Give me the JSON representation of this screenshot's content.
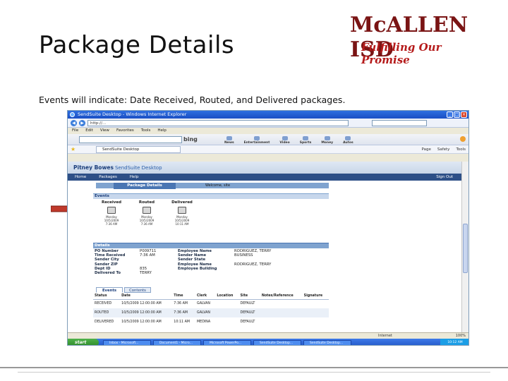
{
  "slide": {
    "title": "Package Details",
    "subtitle": "Events will indicate: Date Received, Routed, and Delivered packages."
  },
  "logo": {
    "name": "McALLEN ISD",
    "tagline": "Fulfilling Our Promise"
  },
  "browser": {
    "window_title": "SendSuite Desktop - Windows Internet Explorer",
    "address": "http://...",
    "menu": [
      "File",
      "Edit",
      "View",
      "Favorites",
      "Tools",
      "Help"
    ],
    "bing": {
      "logo": "bing",
      "items": [
        "News",
        "Entertainment",
        "Video",
        "Sports",
        "Money",
        "Autos"
      ]
    },
    "tab_label": "SendSuite Desktop",
    "tools": [
      "Page",
      "Safety",
      "Tools"
    ]
  },
  "app": {
    "brand": "Pitney Bowes",
    "product": "SendSuite Desktop",
    "nav": [
      "Home",
      "Packages",
      "Help"
    ],
    "signout": "Sign Out",
    "page_title": "Package Details",
    "welcome": "Welcome, site",
    "events_heading": "Events",
    "events": [
      {
        "label": "Received",
        "day": "Monday",
        "date": "10/5/2009",
        "time": "7:36 AM"
      },
      {
        "label": "Routed",
        "day": "Monday",
        "date": "10/5/2009",
        "time": "7:36 AM"
      },
      {
        "label": "Delivered",
        "day": "Monday",
        "date": "10/5/2009",
        "time": "10:11 AM"
      }
    ],
    "details_heading": "Details",
    "details_left_labels": [
      "PO Number",
      "Time Received",
      "Sender City",
      "Sender ZIP",
      "Dept ID",
      "Delivered To"
    ],
    "details_left_values": [
      "P009711",
      "7:36 AM",
      "",
      "",
      "835",
      "TERRY"
    ],
    "details_right_labels": [
      "Employee Name",
      "Sender Name",
      "Sender State",
      "Employee Name",
      "Employee Building"
    ],
    "details_right_values": [
      "RODRIGUEZ, TERRY",
      "BUSINESS",
      "",
      "RODRIGUEZ, TERRY",
      ""
    ],
    "subtabs": [
      "Events",
      "Contents"
    ],
    "table": {
      "headers": [
        "Status",
        "Date",
        "Time",
        "Clerk",
        "Location",
        "Site",
        "Notes/Reference",
        "Signature"
      ],
      "rows": [
        [
          "RECEIVED",
          "10/5/2009 12:00:00 AM",
          "7:36 AM",
          "GALVAN",
          "",
          "DEFAULT",
          "",
          ""
        ],
        [
          "ROUTED",
          "10/5/2009 12:00:00 AM",
          "7:36 AM",
          "GALVAN",
          "",
          "DEFAULT",
          "",
          ""
        ],
        [
          "DELIVERED",
          "10/5/2009 12:00:00 AM",
          "10:11 AM",
          "MEDINA",
          "",
          "DEFAULT",
          "",
          ""
        ]
      ]
    }
  },
  "statusbar": {
    "zone": "Internet",
    "zoom": "100%"
  },
  "taskbar": {
    "start": "start",
    "tasks": [
      "Inbox - Microsoft...",
      "Document1 - Micro...",
      "Microsoft PowerPo...",
      "SendSuite Desktop...",
      "SendSuite Desktop..."
    ],
    "clock": "10:12 AM"
  },
  "colors": {
    "logo_red": "#7a1414",
    "app_nav": "#2d4f87",
    "arrow": "#c0392b"
  }
}
